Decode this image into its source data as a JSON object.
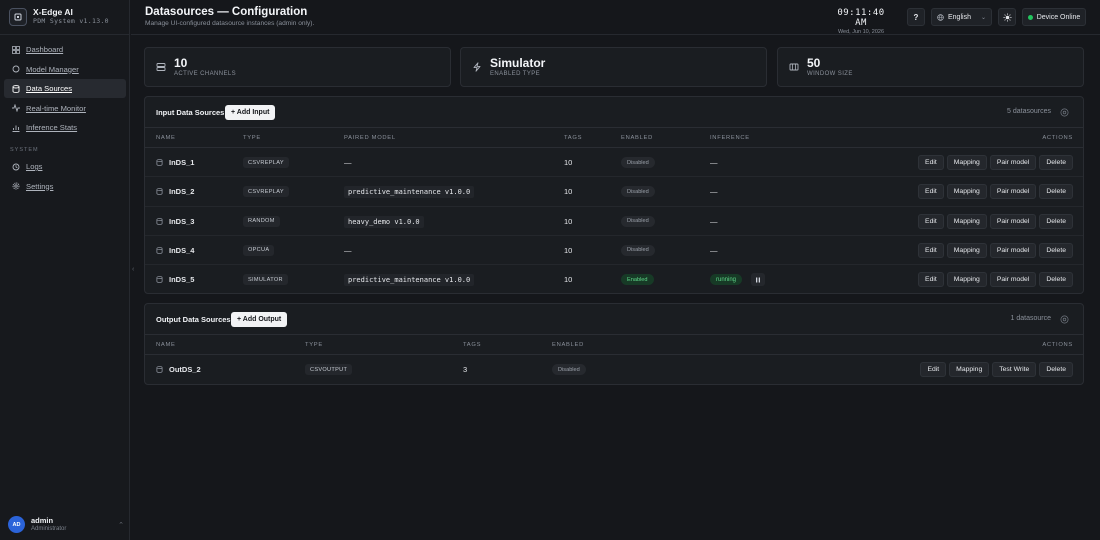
{
  "app": {
    "name": "X-Edge AI",
    "subtitle": "PDM System v1.13.0"
  },
  "sidebar": {
    "items": [
      {
        "label": "Dashboard",
        "icon": "grid-icon"
      },
      {
        "label": "Model Manager",
        "icon": "circle-icon"
      },
      {
        "label": "Data Sources",
        "icon": "database-icon",
        "active": true
      },
      {
        "label": "Real-time Monitor",
        "icon": "activity-icon"
      },
      {
        "label": "Inference Stats",
        "icon": "chart-icon"
      }
    ],
    "section_label": "SYSTEM",
    "system_items": [
      {
        "label": "Logs",
        "icon": "history-icon"
      },
      {
        "label": "Settings",
        "icon": "gear-icon"
      }
    ],
    "user": {
      "initials": "AD",
      "name": "admin",
      "role": "Administrator"
    }
  },
  "header": {
    "title": "Datasources — Configuration",
    "subtitle": "Manage UI-configured datasource instances (admin only).",
    "time": "09:11:40 AM",
    "date": "Wed, Jun 10, 2026",
    "help_label": "?",
    "language": "English",
    "device_status": "Device Online"
  },
  "stats": [
    {
      "value": "10",
      "label": "ACTIVE CHANNELS",
      "icon": "server-icon"
    },
    {
      "value": "Simulator",
      "label": "ENABLED TYPE",
      "icon": "bolt-icon"
    },
    {
      "value": "50",
      "label": "WINDOW SIZE",
      "icon": "window-icon"
    }
  ],
  "input_sources": {
    "title": "Input Data Sources",
    "add_label": "+ Add Input",
    "count_label": "5 datasources",
    "columns": [
      "NAME",
      "TYPE",
      "PAIRED MODEL",
      "TAGS",
      "ENABLED",
      "INFERENCE",
      "ACTIONS"
    ],
    "rows": [
      {
        "name": "InDS_1",
        "type": "CSVREPLAY",
        "model": "—",
        "tags": "10",
        "enabled": "Disabled",
        "inference": "—"
      },
      {
        "name": "InDS_2",
        "type": "CSVREPLAY",
        "model": "predictive_maintenance v1.0.0",
        "tags": "10",
        "enabled": "Disabled",
        "inference": "—"
      },
      {
        "name": "InDS_3",
        "type": "RANDOM",
        "model": "heavy_demo v1.0.0",
        "tags": "10",
        "enabled": "Disabled",
        "inference": "—"
      },
      {
        "name": "InDS_4",
        "type": "OPCUA",
        "model": "—",
        "tags": "10",
        "enabled": "Disabled",
        "inference": "—"
      },
      {
        "name": "InDS_5",
        "type": "SIMULATOR",
        "model": "predictive_maintenance v1.0.0",
        "tags": "10",
        "enabled": "Enabled",
        "inference": "running"
      }
    ],
    "actions": [
      "Edit",
      "Mapping",
      "Pair model",
      "Delete"
    ]
  },
  "output_sources": {
    "title": "Output Data Sources",
    "add_label": "+ Add Output",
    "count_label": "1 datasource",
    "columns": [
      "NAME",
      "TYPE",
      "TAGS",
      "ENABLED",
      "ACTIONS"
    ],
    "rows": [
      {
        "name": "OutDS_2",
        "type": "CSVOUTPUT",
        "tags": "3",
        "enabled": "Disabled"
      }
    ],
    "actions": [
      "Edit",
      "Mapping",
      "Test Write",
      "Delete"
    ]
  }
}
